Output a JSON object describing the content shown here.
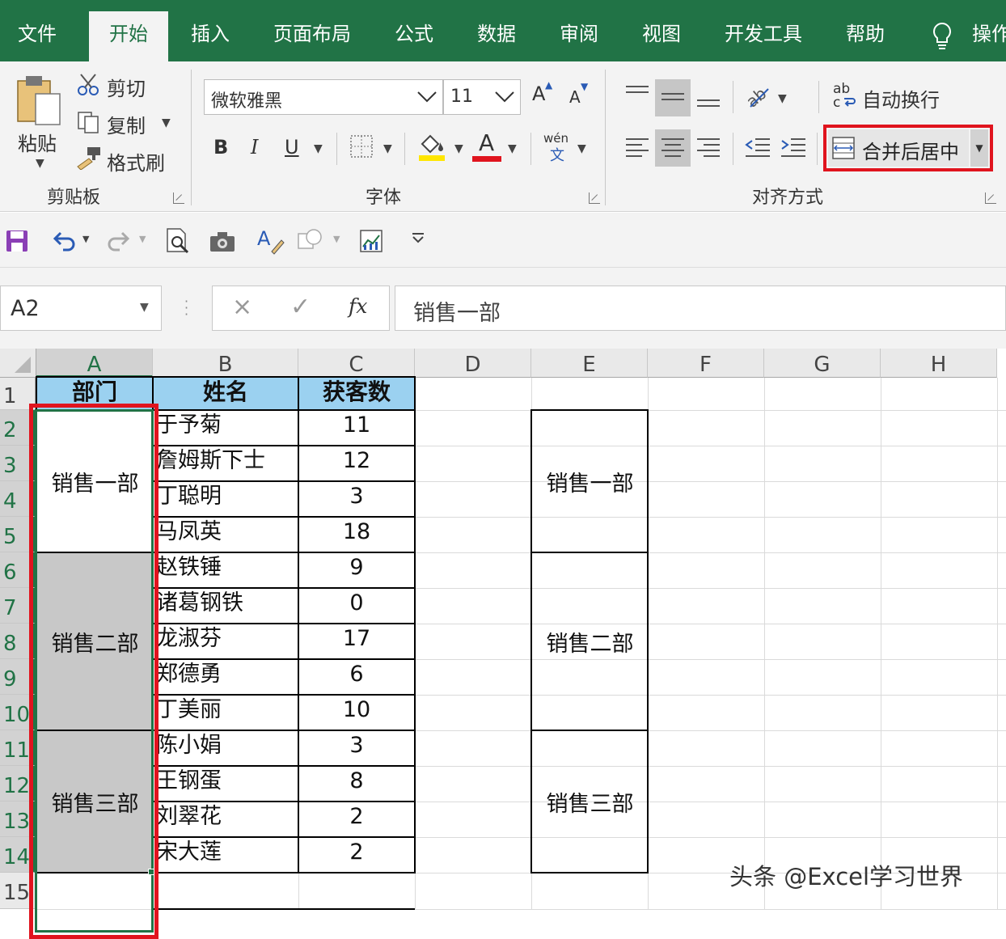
{
  "tabs": [
    "文件",
    "开始",
    "插入",
    "页面布局",
    "公式",
    "数据",
    "审阅",
    "视图",
    "开发工具",
    "帮助",
    "操作"
  ],
  "clipboard": {
    "paste": "粘贴",
    "cut": "剪切",
    "copy": "复制",
    "format_painter": "格式刷",
    "group": "剪贴板"
  },
  "font": {
    "name": "微软雅黑",
    "size": "11",
    "bold": "B",
    "italic": "I",
    "underline": "U",
    "grow": "A",
    "shrink": "A",
    "color_letter": "A",
    "phonetic_top": "wén",
    "phonetic_bottom": "文",
    "group": "字体"
  },
  "alignment": {
    "wrap": "自动换行",
    "merge": "合并后居中",
    "group": "对齐方式",
    "wrap_icon_top": "ab",
    "wrap_icon_bottom": "c"
  },
  "formula_bar": {
    "name_box": "A2",
    "cancel": "×",
    "enter": "✓",
    "fx": "fx",
    "content": "销售一部"
  },
  "columns": [
    "A",
    "B",
    "C",
    "D",
    "E",
    "F",
    "G",
    "H"
  ],
  "rows": [
    "1",
    "2",
    "3",
    "4",
    "5",
    "6",
    "7",
    "8",
    "9",
    "10",
    "11",
    "12",
    "13",
    "14",
    "15"
  ],
  "headers": {
    "dept": "部门",
    "name": "姓名",
    "count": "获客数"
  },
  "people": [
    {
      "name": "于予菊",
      "count": "11"
    },
    {
      "name": "詹姆斯下士",
      "count": "12"
    },
    {
      "name": "丁聪明",
      "count": "3"
    },
    {
      "name": "马凤英",
      "count": "18"
    },
    {
      "name": "赵铁锤",
      "count": "9"
    },
    {
      "name": "诸葛钢铁",
      "count": "0"
    },
    {
      "name": "龙淑芬",
      "count": "17"
    },
    {
      "name": "郑德勇",
      "count": "6"
    },
    {
      "name": "丁美丽",
      "count": "10"
    },
    {
      "name": "陈小娟",
      "count": "3"
    },
    {
      "name": "王钢蛋",
      "count": "8"
    },
    {
      "name": "刘翠花",
      "count": "2"
    },
    {
      "name": "宋大莲",
      "count": "2"
    }
  ],
  "depts": [
    "销售一部",
    "销售二部",
    "销售三部"
  ],
  "watermark": "头条 @Excel学习世界",
  "colors": {
    "excel_green": "#217346",
    "highlight_red": "#e0141e",
    "header_fill": "#9bd1f0",
    "selected_fill": "#c8c8c8"
  }
}
